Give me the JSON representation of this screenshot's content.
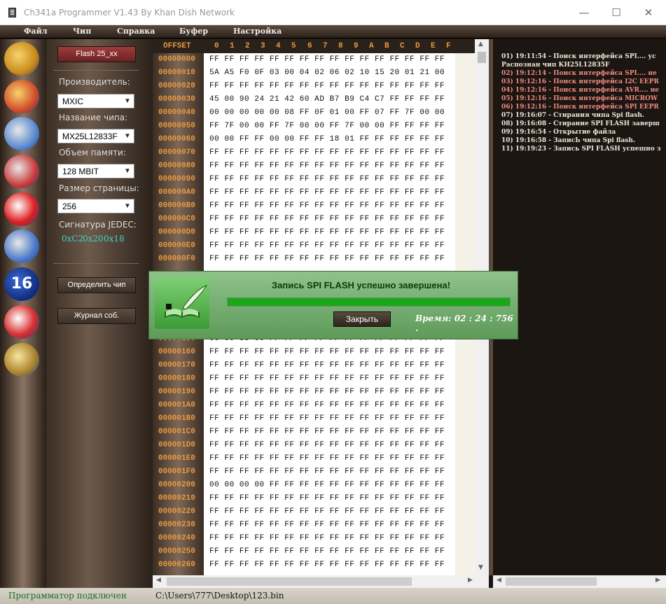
{
  "window": {
    "title": "Ch341a Programmer V1.43 By Khan Dish Network"
  },
  "menu": [
    "Файл",
    "Чип",
    "Справка",
    "Буфер",
    "Настройка"
  ],
  "toolbar_icons": [
    "open-folder-icon",
    "save-folder-icon",
    "read-chip-icon",
    "write-chip-icon",
    "erase-chip-icon",
    "verify-chip-icon",
    "badge-16-icon",
    "blank-check-icon",
    "edit-quill-icon"
  ],
  "toolbar_badge": "16",
  "panel": {
    "chip_button": "Flash 25_xx",
    "manufacturer_label": "Производитель:",
    "manufacturer": "MXIC",
    "chip_name_label": "Название чипа:",
    "chip_name": "MX25L12833F",
    "memory_label": "Объем памяти:",
    "memory": "128 MBIT",
    "page_size_label": "Размер страницы:",
    "page_size": "256",
    "jedec_label": "Сигнатура JEDEC:",
    "jedec": [
      "0xC2",
      "0x20",
      "0x18"
    ],
    "detect_button": "Определить чип",
    "log_button": "Журнал соб."
  },
  "hex": {
    "offset_header": "OFFSET",
    "columns": [
      "0",
      "1",
      "2",
      "3",
      "4",
      "5",
      "6",
      "7",
      "8",
      "9",
      "A",
      "B",
      "C",
      "D",
      "E",
      "F"
    ],
    "rows": [
      {
        "offset": "00000000",
        "bytes": "FF FF FF FF FF FF FF FF FF FF FF FF FF FF FF FF"
      },
      {
        "offset": "00000010",
        "bytes": "5A A5 F0 0F 03 00 04 02 06 02 10 15 20 01 21 00"
      },
      {
        "offset": "00000020",
        "bytes": "FF FF FF FF FF FF FF FF FF FF FF FF FF FF FF FF"
      },
      {
        "offset": "00000030",
        "bytes": "45 00 90 24 21 42 60 AD B7 B9 C4 C7 FF FF FF FF"
      },
      {
        "offset": "00000040",
        "bytes": "00 00 00 00 00 08 FF 0F 01 00 FF 07 FF 7F 00 00"
      },
      {
        "offset": "00000050",
        "bytes": "FF 7F 00 00 FF 7F 00 00 FF 7F 00 00 FF FF FF FF"
      },
      {
        "offset": "00000060",
        "bytes": "00 00 FF FF 00 00 FF FF 18 01 FF FF FF FF FF FF"
      },
      {
        "offset": "00000070",
        "bytes": "FF FF FF FF FF FF FF FF FF FF FF FF FF FF FF FF"
      },
      {
        "offset": "00000080",
        "bytes": "FF FF FF FF FF FF FF FF FF FF FF FF FF FF FF FF"
      },
      {
        "offset": "00000090",
        "bytes": "FF FF FF FF FF FF FF FF FF FF FF FF FF FF FF FF"
      },
      {
        "offset": "000000A0",
        "bytes": "FF FF FF FF FF FF FF FF FF FF FF FF FF FF FF FF"
      },
      {
        "offset": "000000B0",
        "bytes": "FF FF FF FF FF FF FF FF FF FF FF FF FF FF FF FF"
      },
      {
        "offset": "000000C0",
        "bytes": "FF FF FF FF FF FF FF FF FF FF FF FF FF FF FF FF"
      },
      {
        "offset": "000000D0",
        "bytes": "FF FF FF FF FF FF FF FF FF FF FF FF FF FF FF FF"
      },
      {
        "offset": "000000E0",
        "bytes": "FF FF FF FF FF FF FF FF FF FF FF FF FF FF FF FF"
      },
      {
        "offset": "000000F0",
        "bytes": "FF FF FF FF FF FF FF FF FF FF FF FF FF FF FF FF"
      },
      {
        "offset": "",
        "bytes": ""
      },
      {
        "offset": "",
        "bytes": ""
      },
      {
        "offset": "",
        "bytes": ""
      },
      {
        "offset": "",
        "bytes": ""
      },
      {
        "offset": "",
        "bytes": ""
      },
      {
        "offset": "00000150",
        "bytes": "00 00 38 00 FF FF FF FF FF FF FF FF FF FF FF FF"
      },
      {
        "offset": "00000160",
        "bytes": "FF FF FF FF FF FF FF FF FF FF FF FF FF FF FF FF"
      },
      {
        "offset": "00000170",
        "bytes": "FF FF FF FF FF FF FF FF FF FF FF FF FF FF FF FF"
      },
      {
        "offset": "00000180",
        "bytes": "FF FF FF FF FF FF FF FF FF FF FF FF FF FF FF FF"
      },
      {
        "offset": "00000190",
        "bytes": "FF FF FF FF FF FF FF FF FF FF FF FF FF FF FF FF"
      },
      {
        "offset": "000001A0",
        "bytes": "FF FF FF FF FF FF FF FF FF FF FF FF FF FF FF FF"
      },
      {
        "offset": "000001B0",
        "bytes": "FF FF FF FF FF FF FF FF FF FF FF FF FF FF FF FF"
      },
      {
        "offset": "000001C0",
        "bytes": "FF FF FF FF FF FF FF FF FF FF FF FF FF FF FF FF"
      },
      {
        "offset": "000001D0",
        "bytes": "FF FF FF FF FF FF FF FF FF FF FF FF FF FF FF FF"
      },
      {
        "offset": "000001E0",
        "bytes": "FF FF FF FF FF FF FF FF FF FF FF FF FF FF FF FF"
      },
      {
        "offset": "000001F0",
        "bytes": "FF FF FF FF FF FF FF FF FF FF FF FF FF FF FF FF"
      },
      {
        "offset": "00000200",
        "bytes": "00 00 00 00 FF FF FF FF FF FF FF FF FF FF FF FF"
      },
      {
        "offset": "00000210",
        "bytes": "FF FF FF FF FF FF FF FF FF FF FF FF FF FF FF FF"
      },
      {
        "offset": "00000220",
        "bytes": "FF FF FF FF FF FF FF FF FF FF FF FF FF FF FF FF"
      },
      {
        "offset": "00000230",
        "bytes": "FF FF FF FF FF FF FF FF FF FF FF FF FF FF FF FF"
      },
      {
        "offset": "00000240",
        "bytes": "FF FF FF FF FF FF FF FF FF FF FF FF FF FF FF FF"
      },
      {
        "offset": "00000250",
        "bytes": "FF FF FF FF FF FF FF FF FF FF FF FF FF FF FF FF"
      },
      {
        "offset": "00000260",
        "bytes": "FF FF FF FF FF FF FF FF FF FF FF FF FF FF FF FF"
      }
    ]
  },
  "log": [
    {
      "text": "01) 19:11:54  - Поиск интерфейса  SPI.... ус",
      "color": "#f0e6d8"
    },
    {
      "text": "     Распознан чип KH25L12835F",
      "color": "#f0e6d8"
    },
    {
      "text": "02) 19:12:14  - Поиск интерфейса  SPI.... не",
      "color": "#f08a80"
    },
    {
      "text": "03) 19:12:16  - Поиск интерфейса  I2C EEPR",
      "color": "#f08a80"
    },
    {
      "text": "04) 19:12:16  - Поиск интерфейса  AVR.... не",
      "color": "#f08a80"
    },
    {
      "text": "05) 19:12:16  - Поиск интерфейса  MICROW",
      "color": "#f08a80"
    },
    {
      "text": "06) 19:12:16  - Поиск интерфейса  SPI EEPR",
      "color": "#f08a80"
    },
    {
      "text": "07) 19:16:07  - Стирания чипа  Spi flash.",
      "color": "#f0e6d8"
    },
    {
      "text": "08) 19:16:08  - Стирание SPI FLASH заверш",
      "color": "#f0e6d8"
    },
    {
      "text": "09) 19:16:54  - Открытие файла",
      "color": "#f0e6d8"
    },
    {
      "text": "10) 19:16:58  - ЗаписЬ чипа  Spi flash.",
      "color": "#f0e6d8"
    },
    {
      "text": "11) 19:19:23  - Запись SPI FLASH успешно з",
      "color": "#f0e6d8"
    }
  ],
  "dialog": {
    "message": "Запись SPI FLASH успешно завершена!",
    "progress": 1.0,
    "close_button": "Закрыть",
    "time": "Время:  02 : 24 : 756 ."
  },
  "status": {
    "connection": "Программатор подключен",
    "file_path": "C:\\Users\\777\\Desktop\\123.bin"
  },
  "colors": {
    "accent": "#e89840",
    "jedec": "#3ad5c5",
    "progress": "#1aa71a",
    "status_ok": "#1d6b1d"
  }
}
